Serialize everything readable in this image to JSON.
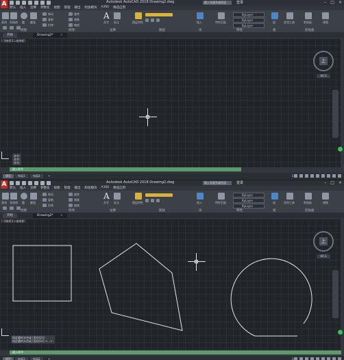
{
  "windows": [
    {
      "id": "before",
      "title": "Autodesk AutoCAD 2018    Drawing2.dwg",
      "search_placeholder": "键入关键字或短语",
      "signin": "登录",
      "menu": [
        "默认",
        "插入",
        "注释",
        "参数化",
        "视图",
        "管理",
        "输出",
        "附加模块",
        "A360",
        "精选应用"
      ],
      "tools": [
        "直线",
        "多段线",
        "圆",
        "圆弧",
        "移动",
        "复制",
        "拉伸",
        "旋转",
        "镜像",
        "缩放",
        "文字",
        "标注",
        "图层特性",
        "插入",
        "特性匹配",
        "组",
        "实用工具",
        "剪贴板",
        "视图"
      ],
      "panels": [
        "绘图",
        "修改",
        "注释",
        "图层",
        "块",
        "特性",
        "组",
        "实用工具",
        "剪贴板"
      ],
      "bylayer": [
        "ByLayer",
        "ByLayer",
        "ByLayer"
      ],
      "tabs": [
        {
          "label": "开始",
          "active": false
        },
        {
          "label": "Drawing2*",
          "active": true
        }
      ],
      "viewport_label": "[-][俯视][二维线框]",
      "viewcube_face": "上",
      "wcs_label": "WCS",
      "command_history": [
        "命令:",
        "命令:",
        "命令:"
      ],
      "command_prompt": "键入命令",
      "layout_tabs": [
        {
          "label": "模型",
          "active": true
        },
        {
          "label": "布局1",
          "active": false
        },
        {
          "label": "布局2",
          "active": false
        },
        {
          "label": "+",
          "active": false
        }
      ],
      "status_scale": "1:1"
    },
    {
      "id": "after",
      "title": "Autodesk AutoCAD 2018    Drawing2.dwg",
      "search_placeholder": "键入关键字或短语",
      "signin": "登录",
      "menu": [
        "默认",
        "插入",
        "注释",
        "参数化",
        "视图",
        "管理",
        "输出",
        "附加模块",
        "A360",
        "精选应用"
      ],
      "tools": [
        "直线",
        "多段线",
        "圆",
        "圆弧",
        "移动",
        "复制",
        "拉伸",
        "旋转",
        "镜像",
        "缩放",
        "文字",
        "标注",
        "图层特性",
        "插入",
        "特性匹配",
        "组",
        "实用工具",
        "剪贴板",
        "视图"
      ],
      "panels": [
        "绘图",
        "修改",
        "注释",
        "图层",
        "块",
        "特性",
        "组",
        "实用工具",
        "剪贴板"
      ],
      "bylayer": [
        "ByLayer",
        "ByLayer",
        "ByLayer"
      ],
      "tabs": [
        {
          "label": "开始",
          "active": false
        },
        {
          "label": "Drawing2*",
          "active": true
        }
      ],
      "viewport_label": "[-][俯视][二维线框]",
      "viewcube_face": "上",
      "wcs_label": "WCS",
      "command_history": [
        "指定圆的半径或 [直径(D)]:",
        "指定圆的半径或 [直径(D)] <…>:"
      ],
      "command_prompt": "键入命令",
      "layout_tabs": [
        {
          "label": "模型",
          "active": true
        },
        {
          "label": "布局1",
          "active": false
        },
        {
          "label": "布局2",
          "active": false
        },
        {
          "label": "+",
          "active": false
        }
      ],
      "status_scale": "1:1"
    }
  ],
  "colors": {
    "accent_logo": "#c42b22",
    "canvas": "#212428",
    "command_bar": "#5b9b6b",
    "status_ok": "#3bbf5a"
  }
}
